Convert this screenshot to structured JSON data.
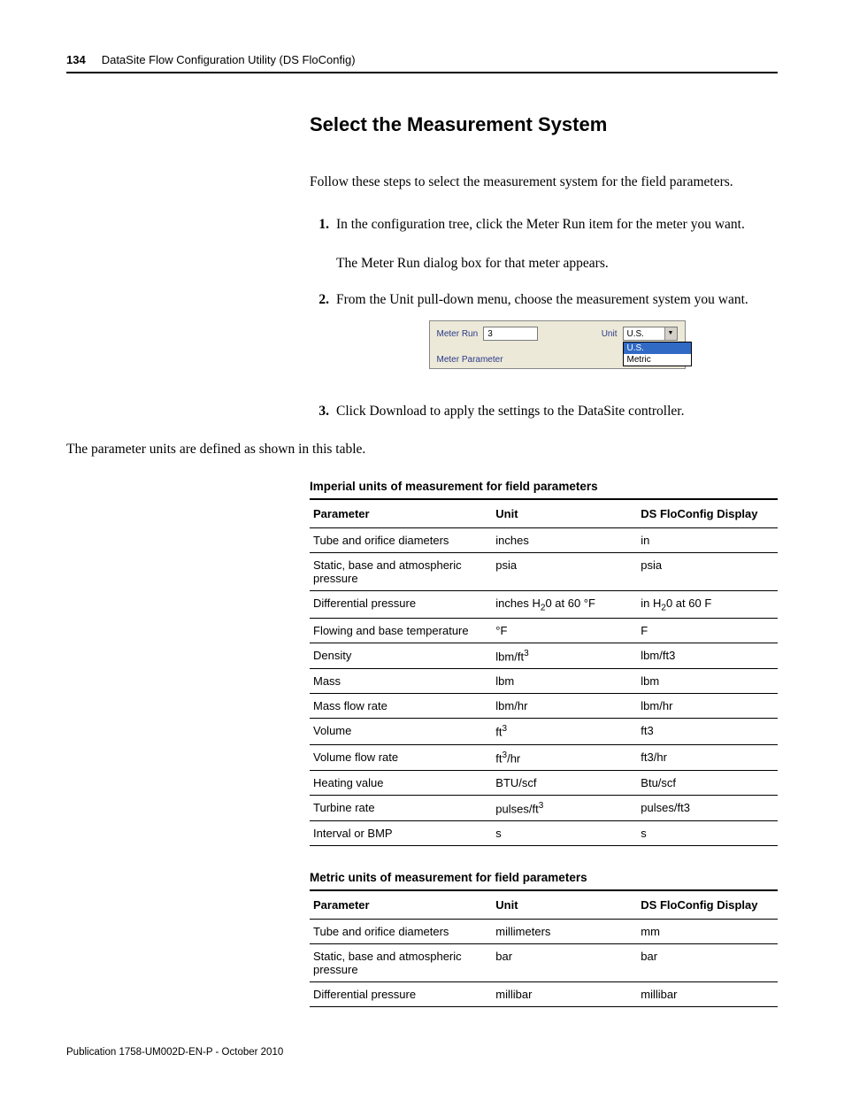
{
  "header": {
    "page_number": "134",
    "doc_title": "DataSite Flow Configuration Utility (DS FloConfig)"
  },
  "section": {
    "title": "Select the Measurement System",
    "intro": "Follow these steps to select the measurement system for the field parameters.",
    "steps": [
      {
        "num": "1.",
        "text": "In the configuration tree, click the Meter Run item for the meter you want.",
        "subtext": "The Meter Run dialog box for that meter appears."
      },
      {
        "num": "2.",
        "text": "From the Unit pull-down menu, choose the measurement system you want."
      },
      {
        "num": "3.",
        "text": "Click Download to apply the settings to the DataSite controller."
      }
    ],
    "after_steps": "The parameter units are defined as shown in this table."
  },
  "screenshot": {
    "meter_run_label": "Meter Run",
    "meter_run_value": "3",
    "unit_label": "Unit",
    "unit_value": "U.S.",
    "options": [
      "U.S.",
      "Metric"
    ],
    "fieldset_label": "Meter Parameter"
  },
  "table_imperial": {
    "caption": "Imperial units of measurement for field parameters",
    "headers": [
      "Parameter",
      "Unit",
      "DS FloConfig Display"
    ],
    "rows": [
      [
        "Tube and orifice diameters",
        "inches",
        "in"
      ],
      [
        "Static, base and atmospheric pressure",
        "psia",
        "psia"
      ],
      [
        "Differential pressure",
        "inches H₂0 at 60 °F",
        "in H₂0 at 60 F"
      ],
      [
        "Flowing and base temperature",
        "°F",
        "F"
      ],
      [
        "Density",
        "lbm/ft³",
        "lbm/ft3"
      ],
      [
        "Mass",
        "lbm",
        "lbm"
      ],
      [
        "Mass flow rate",
        "lbm/hr",
        "lbm/hr"
      ],
      [
        "Volume",
        "ft³",
        "ft3"
      ],
      [
        "Volume flow rate",
        "ft³/hr",
        "ft3/hr"
      ],
      [
        "Heating value",
        "BTU/scf",
        "Btu/scf"
      ],
      [
        "Turbine rate",
        "pulses/ft³",
        "pulses/ft3"
      ],
      [
        "Interval or BMP",
        "s",
        "s"
      ]
    ]
  },
  "table_metric": {
    "caption": "Metric units of measurement for field parameters",
    "headers": [
      "Parameter",
      "Unit",
      "DS FloConfig Display"
    ],
    "rows": [
      [
        "Tube and orifice diameters",
        "millimeters",
        "mm"
      ],
      [
        "Static, base and atmospheric pressure",
        "bar",
        "bar"
      ],
      [
        "Differential pressure",
        "millibar",
        "millibar"
      ]
    ]
  },
  "footer": "Publication 1758-UM002D-EN-P - October 2010"
}
